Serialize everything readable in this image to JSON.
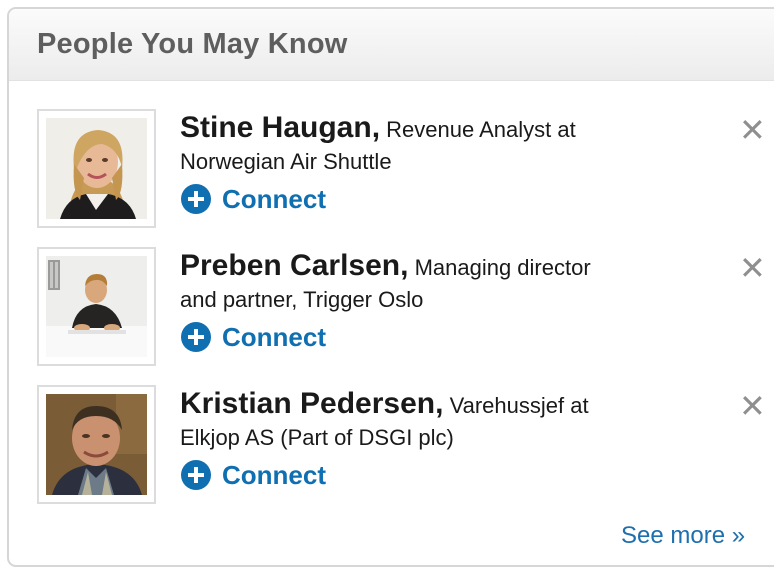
{
  "widget": {
    "title": "People You May Know",
    "see_more": "See more »"
  },
  "people": [
    {
      "name": "Stine Haugan,",
      "headline_first": "Revenue Analyst at",
      "headline_second": "Norwegian Air Shuttle",
      "connect_label": "Connect",
      "dismiss_label": "✕"
    },
    {
      "name": "Preben Carlsen,",
      "headline_first": "Managing director",
      "headline_second": "and partner, Trigger Oslo",
      "connect_label": "Connect",
      "dismiss_label": "✕"
    },
    {
      "name": "Kristian Pedersen,",
      "headline_first": "Varehussjef at",
      "headline_second": "Elkjop AS (Part of DSGI plc)",
      "connect_label": "Connect",
      "dismiss_label": "✕"
    }
  ],
  "icons": {
    "connect": "plus-circle-icon",
    "dismiss": "close-icon"
  },
  "colors": {
    "link": "#0f6fb1",
    "header_text": "#5e5e5e",
    "dismiss": "#8f8f8f"
  }
}
